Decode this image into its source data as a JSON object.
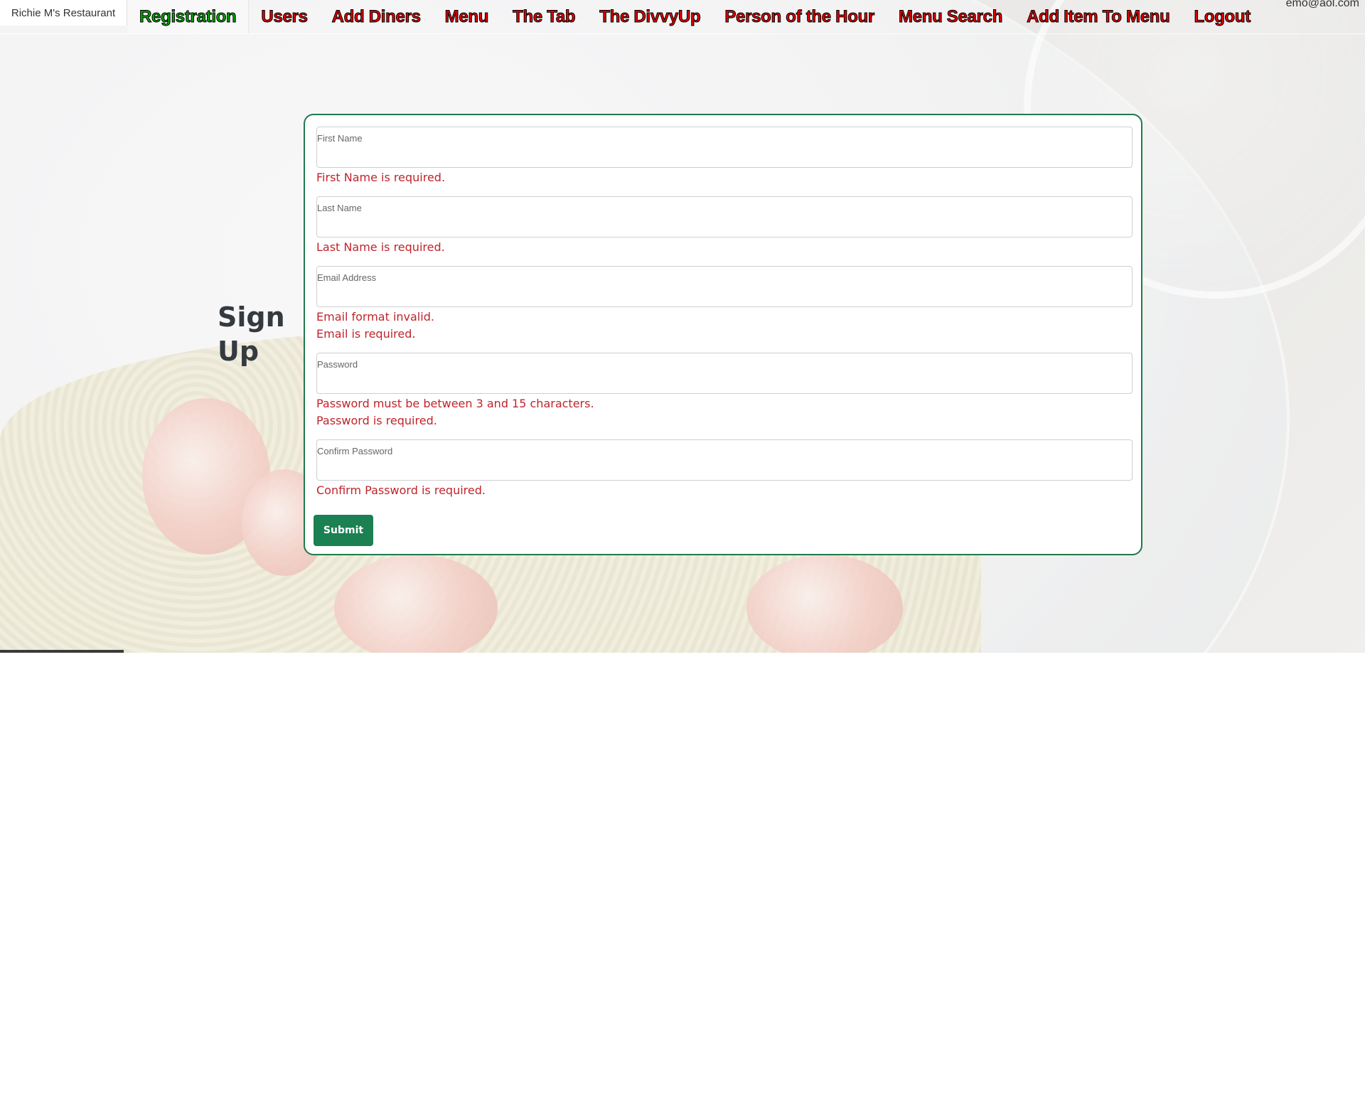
{
  "header": {
    "brand": "Richie M's Restaurant",
    "user_email": "emo@aol.com",
    "nav_items": [
      {
        "label": "Registration",
        "active": true
      },
      {
        "label": "Users",
        "active": false
      },
      {
        "label": "Add Diners",
        "active": false
      },
      {
        "label": "Menu",
        "active": false
      },
      {
        "label": "The Tab",
        "active": false
      },
      {
        "label": "The DivvyUp",
        "active": false
      },
      {
        "label": "Person of the Hour",
        "active": false
      },
      {
        "label": "Menu Search",
        "active": false
      },
      {
        "label": "Add Item To Menu",
        "active": false
      },
      {
        "label": "Logout",
        "active": false
      }
    ]
  },
  "page": {
    "heading": "Sign Up"
  },
  "form": {
    "fields": [
      {
        "label": "First Name",
        "value": "",
        "errors": [
          "First Name is required."
        ]
      },
      {
        "label": "Last Name",
        "value": "",
        "errors": [
          "Last Name is required."
        ]
      },
      {
        "label": "Email Address",
        "value": "",
        "errors": [
          "Email format invalid.",
          "Email is required."
        ]
      },
      {
        "label": "Password",
        "value": "",
        "errors": [
          "Password must be between 3 and 15 characters.",
          "Password is required."
        ]
      },
      {
        "label": "Confirm Password",
        "value": "",
        "errors": [
          "Confirm Password is required."
        ]
      }
    ],
    "submit_label": "Submit"
  },
  "colors": {
    "nav_active": "#00a000",
    "nav_inactive": "#e00000",
    "error": "#c0242b",
    "submit": "#1b8052",
    "card_border": "#1f7a4c"
  }
}
